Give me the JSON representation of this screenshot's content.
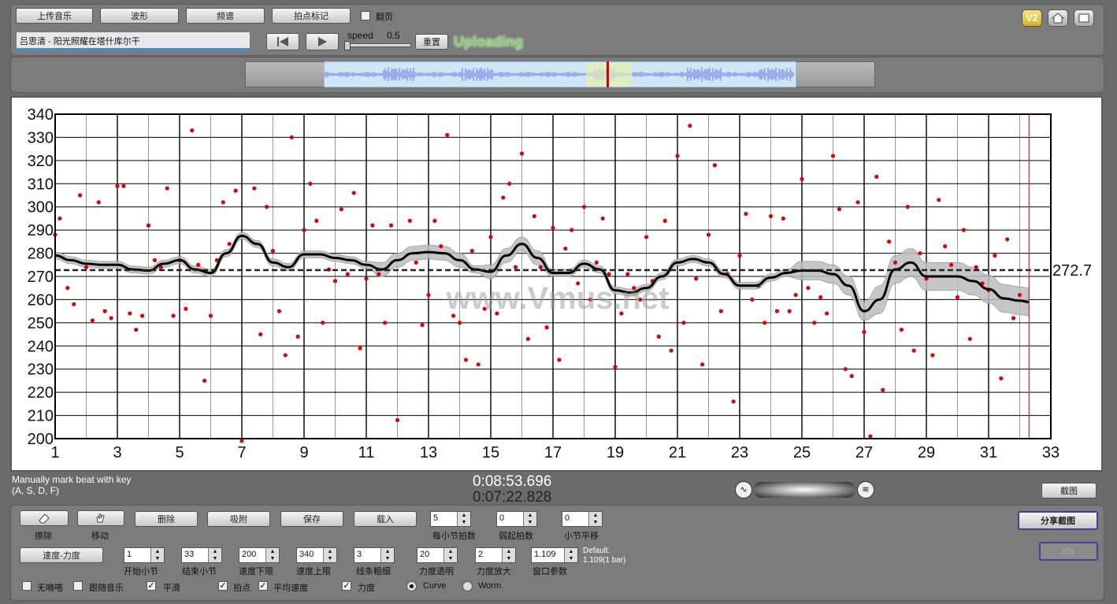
{
  "toolbar": {
    "upload_label": "上传音乐",
    "waveform_label": "波形",
    "spectrum_label": "频谱",
    "beat_mark_label": "拍点标记",
    "flip_label": "翻页",
    "song_title": "吕思清 - 阳光照耀在塔什库尔干",
    "speed_label": "speed",
    "speed_value": "0.5",
    "reset_label": "重置",
    "status": "Uploading"
  },
  "corner_icons": [
    "v2-icon",
    "home-icon",
    "fullscreen-icon"
  ],
  "corner_v2_label": "V2",
  "overview": {
    "accent": "#7b85e6"
  },
  "watermark": "www.Vmus.net",
  "chart_data": {
    "type": "scatter",
    "title": "",
    "xlabel": "",
    "ylabel": "",
    "xlim": [
      1,
      33
    ],
    "ylim": [
      200,
      340
    ],
    "x_ticks": [
      "1",
      "3",
      "5",
      "7",
      "9",
      "11",
      "13",
      "15",
      "17",
      "19",
      "21",
      "23",
      "25",
      "27",
      "29",
      "31",
      "33"
    ],
    "y_ticks": [
      "340",
      "330",
      "320",
      "310",
      "300",
      "290",
      "280",
      "270",
      "260",
      "250",
      "240",
      "230",
      "220",
      "210",
      "200"
    ],
    "mean_value": 272.7,
    "mean_label": "272.7",
    "grid": true,
    "cursor_x": 32.3,
    "series": [
      {
        "kind": "points",
        "color": "#e00000",
        "points": [
          [
            1.0,
            288
          ],
          [
            1.15,
            295
          ],
          [
            1.4,
            265
          ],
          [
            1.6,
            258
          ],
          [
            1.8,
            305
          ],
          [
            2.0,
            274
          ],
          [
            2.2,
            251
          ],
          [
            2.4,
            302
          ],
          [
            2.6,
            255
          ],
          [
            2.8,
            252
          ],
          [
            3.0,
            309
          ],
          [
            3.2,
            309
          ],
          [
            3.4,
            254
          ],
          [
            3.6,
            247
          ],
          [
            3.8,
            253
          ],
          [
            4.0,
            292
          ],
          [
            4.2,
            277
          ],
          [
            4.4,
            274
          ],
          [
            4.6,
            308
          ],
          [
            4.8,
            253
          ],
          [
            5.0,
            277
          ],
          [
            5.2,
            256
          ],
          [
            5.4,
            333
          ],
          [
            5.6,
            275
          ],
          [
            5.8,
            225
          ],
          [
            6.0,
            253
          ],
          [
            6.2,
            277
          ],
          [
            6.4,
            302
          ],
          [
            6.6,
            284
          ],
          [
            6.8,
            307
          ],
          [
            7.0,
            199
          ],
          [
            7.4,
            308
          ],
          [
            7.6,
            245
          ],
          [
            7.8,
            300
          ],
          [
            8.0,
            281
          ],
          [
            8.2,
            255
          ],
          [
            8.4,
            236
          ],
          [
            8.6,
            330
          ],
          [
            8.8,
            244
          ],
          [
            9.0,
            290
          ],
          [
            9.2,
            310
          ],
          [
            9.4,
            294
          ],
          [
            9.6,
            250
          ],
          [
            9.8,
            273
          ],
          [
            10.0,
            268
          ],
          [
            10.2,
            299
          ],
          [
            10.4,
            271
          ],
          [
            10.6,
            306
          ],
          [
            10.8,
            239
          ],
          [
            11.0,
            269
          ],
          [
            11.2,
            292
          ],
          [
            11.4,
            271
          ],
          [
            11.6,
            250
          ],
          [
            11.8,
            292
          ],
          [
            12.0,
            208
          ],
          [
            12.4,
            294
          ],
          [
            12.6,
            276
          ],
          [
            12.8,
            249
          ],
          [
            13.0,
            262
          ],
          [
            13.2,
            294
          ],
          [
            13.4,
            283
          ],
          [
            13.6,
            331
          ],
          [
            13.8,
            253
          ],
          [
            14.0,
            250
          ],
          [
            14.2,
            234
          ],
          [
            14.4,
            281
          ],
          [
            14.6,
            232
          ],
          [
            14.8,
            256
          ],
          [
            15.0,
            287
          ],
          [
            15.2,
            254
          ],
          [
            15.4,
            304
          ],
          [
            15.6,
            310
          ],
          [
            15.8,
            274
          ],
          [
            16.0,
            323
          ],
          [
            16.2,
            243
          ],
          [
            16.4,
            296
          ],
          [
            16.6,
            274
          ],
          [
            16.8,
            248
          ],
          [
            17.0,
            291
          ],
          [
            17.2,
            234
          ],
          [
            17.4,
            282
          ],
          [
            17.6,
            290
          ],
          [
            17.8,
            267
          ],
          [
            18.0,
            300
          ],
          [
            18.2,
            260
          ],
          [
            18.4,
            276
          ],
          [
            18.6,
            295
          ],
          [
            18.8,
            271
          ],
          [
            19.0,
            231
          ],
          [
            19.2,
            254
          ],
          [
            19.4,
            271
          ],
          [
            19.6,
            265
          ],
          [
            19.8,
            260
          ],
          [
            20.0,
            287
          ],
          [
            20.2,
            268
          ],
          [
            20.4,
            244
          ],
          [
            20.6,
            294
          ],
          [
            20.8,
            238
          ],
          [
            21.0,
            322
          ],
          [
            21.2,
            250
          ],
          [
            21.4,
            335
          ],
          [
            21.6,
            269
          ],
          [
            21.8,
            232
          ],
          [
            22.0,
            288
          ],
          [
            22.2,
            318
          ],
          [
            22.4,
            255
          ],
          [
            22.6,
            271
          ],
          [
            22.8,
            216
          ],
          [
            23.0,
            279
          ],
          [
            23.2,
            297
          ],
          [
            23.4,
            260
          ],
          [
            23.6,
            266
          ],
          [
            23.8,
            250
          ],
          [
            24.0,
            296
          ],
          [
            24.2,
            255
          ],
          [
            24.4,
            295
          ],
          [
            24.6,
            255
          ],
          [
            24.8,
            262
          ],
          [
            25.0,
            312
          ],
          [
            25.2,
            265
          ],
          [
            25.4,
            250
          ],
          [
            25.6,
            261
          ],
          [
            25.8,
            254
          ],
          [
            26.0,
            322
          ],
          [
            26.2,
            299
          ],
          [
            26.4,
            230
          ],
          [
            26.6,
            227
          ],
          [
            26.8,
            302
          ],
          [
            27.0,
            246
          ],
          [
            27.2,
            201
          ],
          [
            27.4,
            313
          ],
          [
            27.6,
            221
          ],
          [
            27.8,
            285
          ],
          [
            28.0,
            276
          ],
          [
            28.2,
            247
          ],
          [
            28.4,
            300
          ],
          [
            28.6,
            238
          ],
          [
            28.8,
            280
          ],
          [
            29.0,
            269
          ],
          [
            29.2,
            236
          ],
          [
            29.4,
            303
          ],
          [
            29.6,
            283
          ],
          [
            29.8,
            275
          ],
          [
            30.0,
            261
          ],
          [
            30.2,
            290
          ],
          [
            30.4,
            243
          ],
          [
            30.6,
            274
          ],
          [
            30.8,
            267
          ],
          [
            31.0,
            264
          ],
          [
            31.2,
            279
          ],
          [
            31.4,
            226
          ],
          [
            31.6,
            286
          ],
          [
            31.8,
            252
          ],
          [
            32.0,
            262
          ]
        ]
      },
      {
        "kind": "smooth-line",
        "color": "#000000",
        "points": [
          [
            1,
            279
          ],
          [
            1.5,
            277
          ],
          [
            2,
            275.5
          ],
          [
            2.5,
            275
          ],
          [
            3,
            275
          ],
          [
            3.5,
            273
          ],
          [
            4,
            272.5
          ],
          [
            4.5,
            275.5
          ],
          [
            5,
            277
          ],
          [
            5.5,
            273
          ],
          [
            6,
            271.5
          ],
          [
            6.5,
            280
          ],
          [
            7,
            287.5
          ],
          [
            7.5,
            284
          ],
          [
            8,
            276
          ],
          [
            8.5,
            274
          ],
          [
            9,
            279.5
          ],
          [
            9.5,
            279.5
          ],
          [
            10,
            278
          ],
          [
            10.5,
            277
          ],
          [
            11,
            275
          ],
          [
            11.5,
            273
          ],
          [
            12,
            277
          ],
          [
            12.5,
            280
          ],
          [
            13,
            280.5
          ],
          [
            13.5,
            280
          ],
          [
            14,
            277
          ],
          [
            14.5,
            273
          ],
          [
            15,
            272
          ],
          [
            15.5,
            279
          ],
          [
            16,
            284
          ],
          [
            16.5,
            278
          ],
          [
            17,
            271.5
          ],
          [
            17.5,
            271.5
          ],
          [
            18,
            275.5
          ],
          [
            18.5,
            273
          ],
          [
            19,
            264
          ],
          [
            19.5,
            263
          ],
          [
            20,
            265
          ],
          [
            20.5,
            270
          ],
          [
            21,
            276
          ],
          [
            21.5,
            277.5
          ],
          [
            22,
            276
          ],
          [
            22.5,
            271
          ],
          [
            23,
            266
          ],
          [
            23.5,
            266
          ],
          [
            24,
            269.5
          ],
          [
            24.5,
            271.5
          ],
          [
            25,
            272.5
          ],
          [
            25.5,
            272.5
          ],
          [
            26,
            271
          ],
          [
            26.5,
            266
          ],
          [
            27,
            255
          ],
          [
            27.5,
            260
          ],
          [
            28,
            273
          ],
          [
            28.5,
            276
          ],
          [
            29,
            270
          ],
          [
            29.5,
            270
          ],
          [
            30,
            270
          ],
          [
            30.5,
            268
          ],
          [
            31,
            264.5
          ],
          [
            31.5,
            260.5
          ],
          [
            32,
            259.5
          ],
          [
            32.3,
            259
          ]
        ]
      }
    ]
  },
  "status_left_line1": "Manually mark beat with key",
  "status_left_line2": "(A, S, D, F)",
  "time_total": "0:08:53.696",
  "time_current": "0:07:22.828",
  "screenshot_label": "截图",
  "controls": {
    "erase_label": "擦除",
    "move_label": "移动",
    "delete_label": "删除",
    "snap_label": "吸附",
    "save_label": "保存",
    "load_label": "载入",
    "beats_per_bar": {
      "value": "5",
      "label": "每小节拍数"
    },
    "weak_beats": {
      "value": "0",
      "label": "弱起拍数"
    },
    "bar_shift": {
      "value": "0",
      "label": "小节平移"
    },
    "share_label": "分享截图",
    "ioi_label": "IOI",
    "mode_label": "速度-力度",
    "start_bar": {
      "value": "1",
      "label": "开始小节"
    },
    "end_bar": {
      "value": "33",
      "label": "结束小节"
    },
    "tempo_min": {
      "value": "200",
      "label": "速度下限"
    },
    "tempo_max": {
      "value": "340",
      "label": "速度上限"
    },
    "line_width": {
      "value": "3",
      "label": "线条粗细"
    },
    "dyn_opacity": {
      "value": "20",
      "label": "力度透明"
    },
    "dyn_scale": {
      "value": "2",
      "label": "力度放大"
    },
    "window_param": {
      "value": "1.109",
      "label": "窗口参数"
    },
    "default_line1": "Default:",
    "default_line2": "1.109(1 bar)",
    "mute_label": "无嘀嗒",
    "follow_label": "跟随音乐",
    "smooth_label": "平滑",
    "beat_label": "拍点",
    "avg_tempo_label": "平均速度",
    "dynamics_label": "力度",
    "curve_label": "Curve",
    "worm_label": "Worm"
  }
}
